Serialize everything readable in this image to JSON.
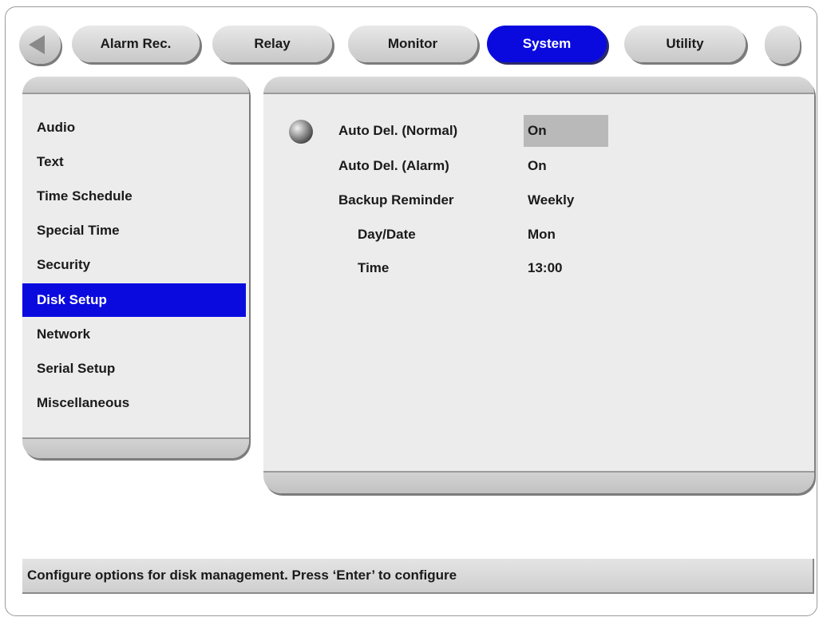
{
  "tabs": [
    {
      "label": "Alarm Rec.",
      "active": false
    },
    {
      "label": "Relay",
      "active": false
    },
    {
      "label": "Monitor",
      "active": false
    },
    {
      "label": "System",
      "active": true
    },
    {
      "label": "Utility",
      "active": false
    }
  ],
  "menu": [
    {
      "label": "Audio"
    },
    {
      "label": "Text"
    },
    {
      "label": "Time Schedule"
    },
    {
      "label": "Special Time"
    },
    {
      "label": "Security"
    },
    {
      "label": "Disk Setup",
      "selected": true
    },
    {
      "label": "Network"
    },
    {
      "label": "Serial Setup"
    },
    {
      "label": "Miscellaneous"
    }
  ],
  "settings": [
    {
      "label": "Auto Del. (Normal)",
      "value": "On"
    },
    {
      "label": "Auto Del. (Alarm)",
      "value": "On"
    },
    {
      "label": "Backup Reminder",
      "value": "Weekly"
    },
    {
      "label": "Day/Date",
      "value": "Mon"
    },
    {
      "label": "Time",
      "value": "13:00"
    }
  ],
  "status": "Configure options for disk management. Press ‘Enter’ to configure",
  "colors": {
    "accent": "#0a0adf",
    "panel": "#ececec",
    "focus": "#b9b9b9"
  },
  "icons": {
    "back": "left-arrow-icon",
    "bullet": "selection-bullet-icon"
  }
}
